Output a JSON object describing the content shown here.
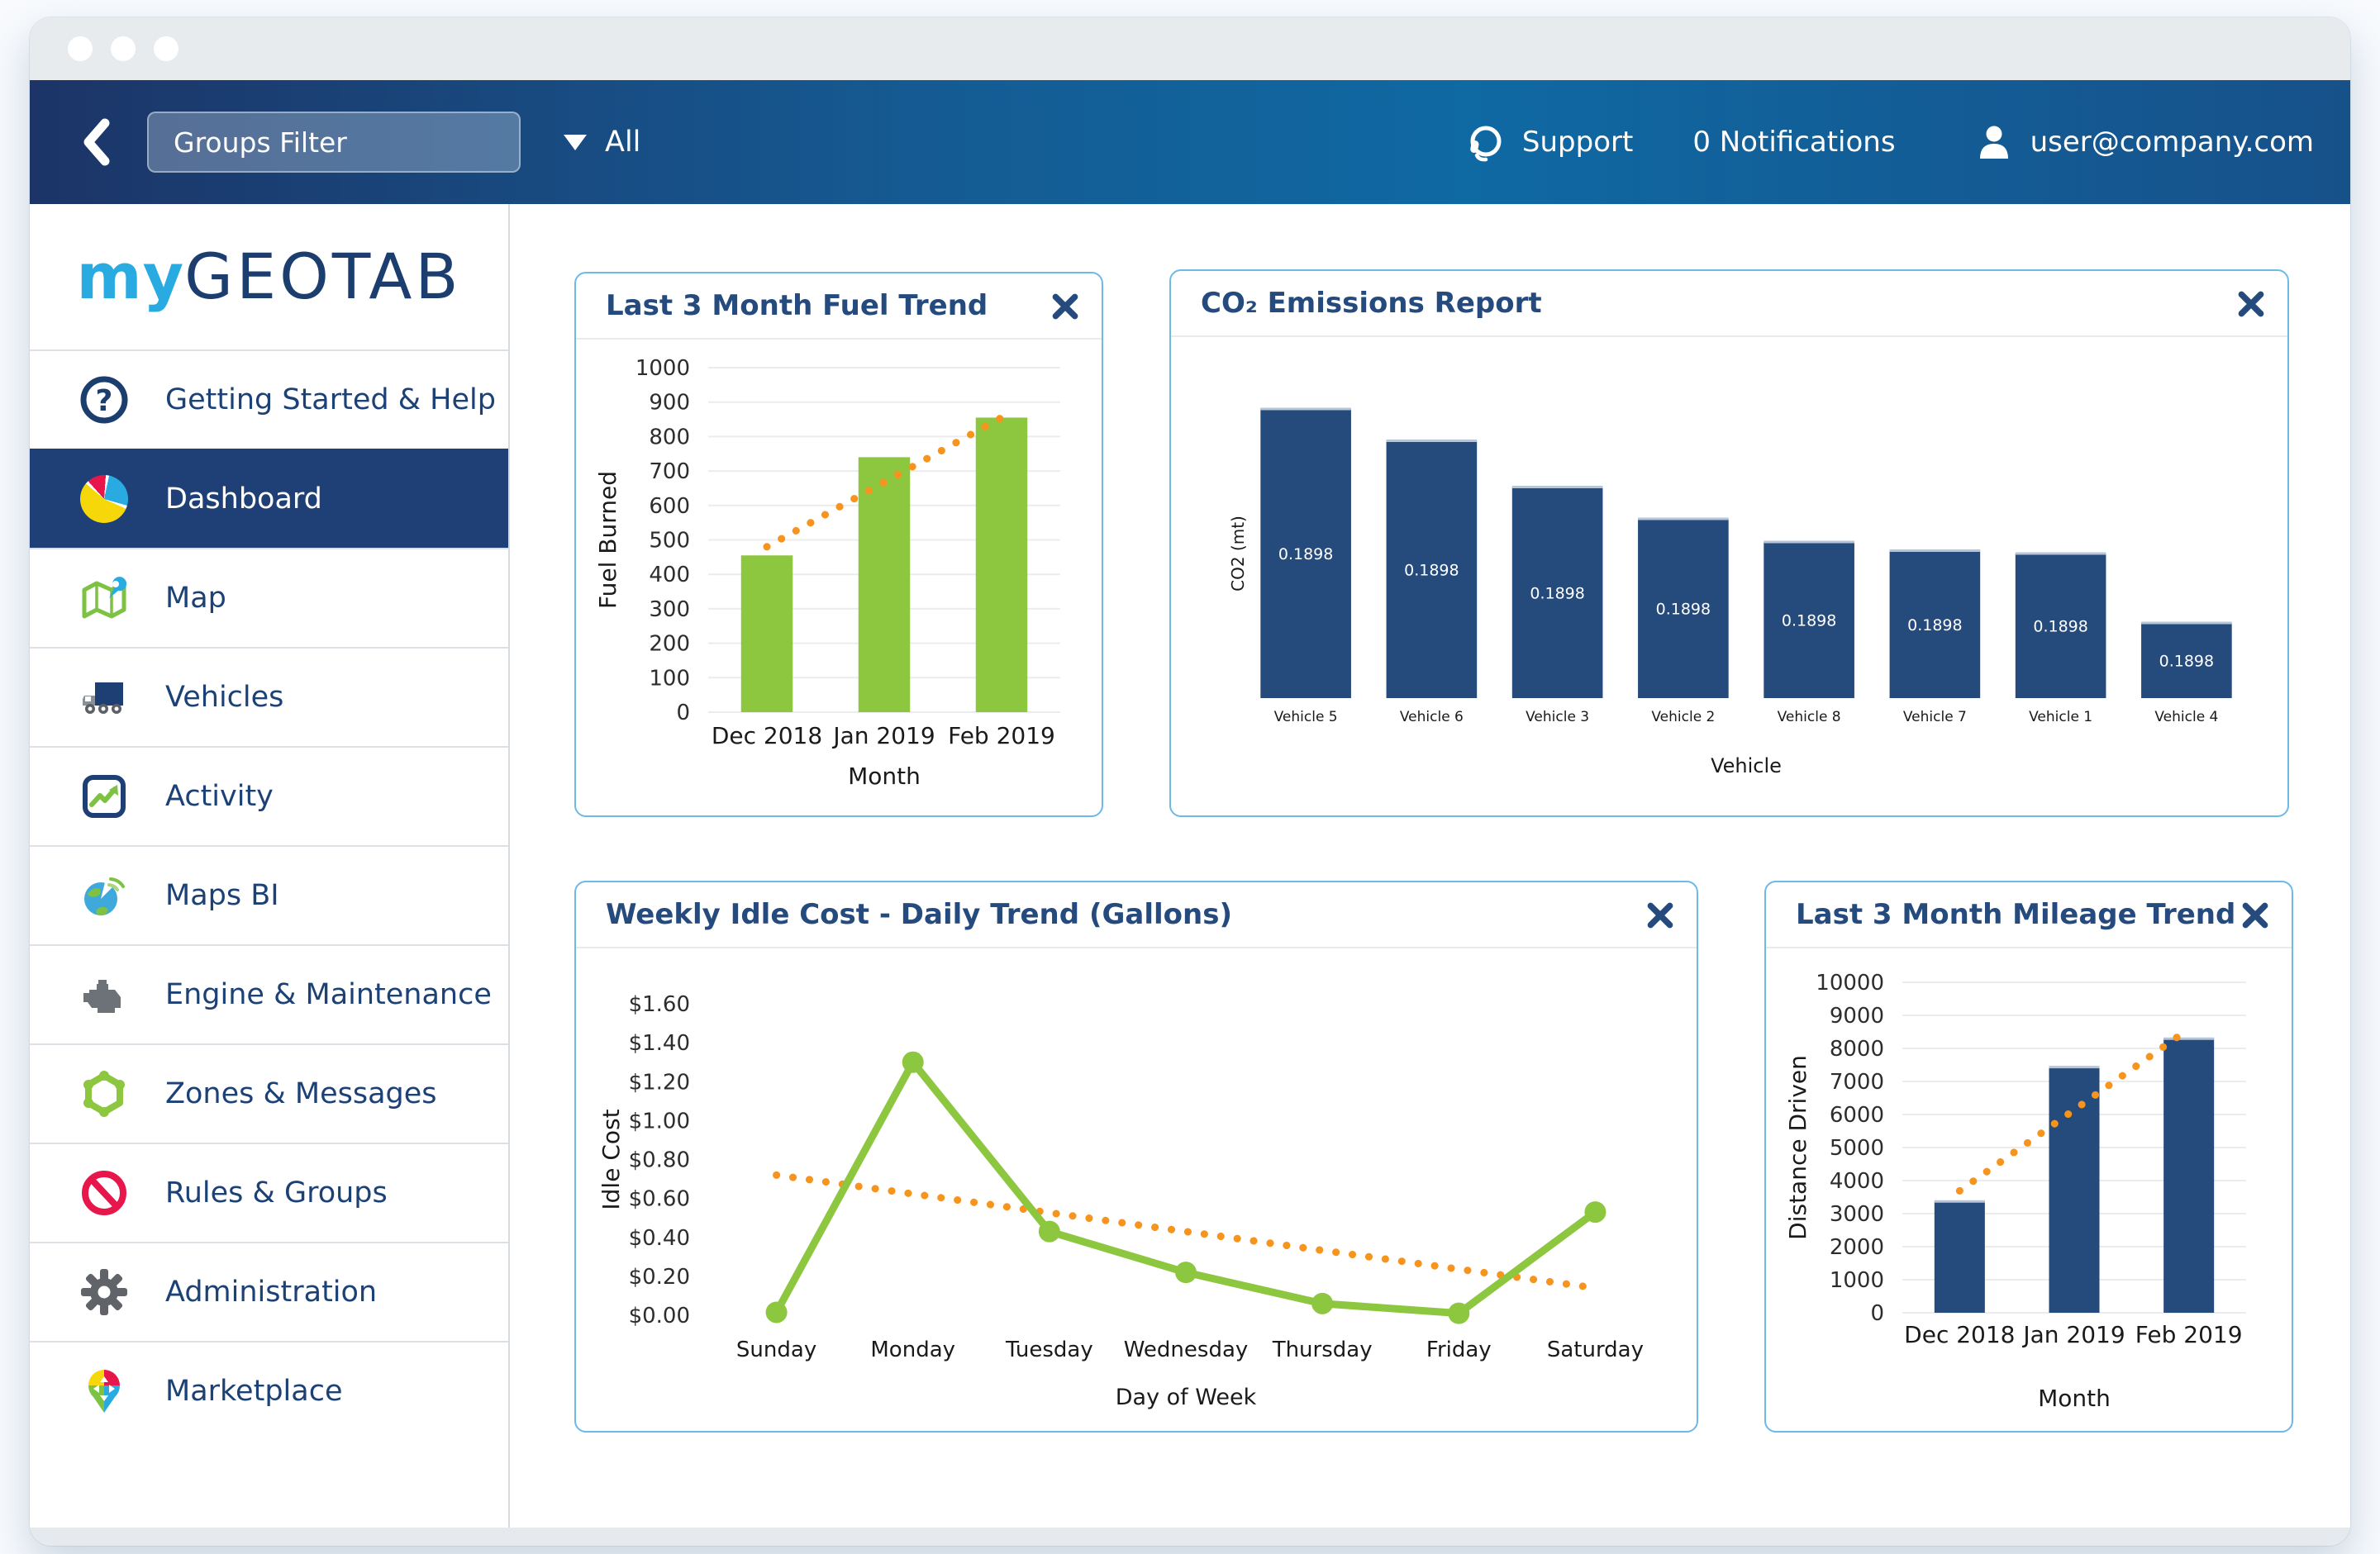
{
  "nav": {
    "groups_filter_label": "Groups Filter",
    "dropdown_value": "All",
    "support_label": "Support",
    "notifications_label": "0 Notifications",
    "user_email": "user@company.com"
  },
  "logo": {
    "part1": "my",
    "part2": "GEOTAB"
  },
  "sidebar": {
    "items": [
      {
        "label": "Getting Started & Help",
        "icon": "help-icon",
        "selected": false
      },
      {
        "label": "Dashboard",
        "icon": "dashboard-pie-icon",
        "selected": true
      },
      {
        "label": "Map",
        "icon": "map-icon",
        "selected": false
      },
      {
        "label": "Vehicles",
        "icon": "truck-icon",
        "selected": false
      },
      {
        "label": "Activity",
        "icon": "activity-icon",
        "selected": false
      },
      {
        "label": "Maps BI",
        "icon": "globe-icon",
        "selected": false
      },
      {
        "label": "Engine & Maintenance",
        "icon": "engine-icon",
        "selected": false
      },
      {
        "label": "Zones & Messages",
        "icon": "zones-icon",
        "selected": false
      },
      {
        "label": "Rules & Groups",
        "icon": "no-entry-icon",
        "selected": false
      },
      {
        "label": "Administration",
        "icon": "gear-icon",
        "selected": false
      },
      {
        "label": "Marketplace",
        "icon": "marketplace-pin-icon",
        "selected": false
      }
    ]
  },
  "colors": {
    "header_gradient": [
      "#1c3467",
      "#0f69a3",
      "#17518a"
    ],
    "accent_navy": "#1e4077",
    "title_navy": "#254a7d",
    "sidebar_text": "#1c4176",
    "logo_blue": "#29abe2",
    "logo_navy": "#1b3e6f",
    "green": "#8dc63f",
    "orange": "#f7941e",
    "bar_navy": "#254a7c",
    "card_border": "#6db9e8"
  },
  "chart_data": [
    {
      "id": "fuel_trend",
      "type": "bar",
      "title": "Last 3 Month Fuel Trend",
      "categories": [
        "Dec 2018",
        "Jan 2019",
        "Feb 2019"
      ],
      "values": [
        455,
        740,
        855
      ],
      "trendline": {
        "start": 480,
        "end": 855
      },
      "ylim": [
        0,
        1000
      ],
      "ytick_step": 100,
      "ytick_decimals": 0,
      "grid": true,
      "xlabel": "Month",
      "ylabel": "Fuel Burned",
      "bar_color": "#8dc63f",
      "trend_color": "#f7941e"
    },
    {
      "id": "co2_emissions",
      "type": "bar",
      "title": "CO₂ Emissions Report",
      "categories": [
        "Vehicle 5",
        "Vehicle 6",
        "Vehicle 3",
        "Vehicle 2",
        "Vehicle 8",
        "Vehicle 7",
        "Vehicle 1",
        "Vehicle 4"
      ],
      "values": [
        1.0,
        0.89,
        0.73,
        0.62,
        0.54,
        0.51,
        0.5,
        0.26
      ],
      "bar_labels": [
        "0.1898",
        "0.1898",
        "0.1898",
        "0.1898",
        "0.1898",
        "0.1898",
        "0.1898",
        "0.1898"
      ],
      "ylim": [
        0,
        1
      ],
      "grid": false,
      "xlabel": "Vehicle",
      "ylabel": "CO2 (mt)",
      "bar_color": "#254a7c"
    },
    {
      "id": "idle_cost",
      "type": "line",
      "title": "Weekly Idle Cost - Daily Trend (Gallons)",
      "categories": [
        "Sunday",
        "Monday",
        "Tuesday",
        "Wednesday",
        "Thursday",
        "Friday",
        "Saturday"
      ],
      "values": [
        0.015,
        1.3,
        0.43,
        0.22,
        0.06,
        0.01,
        0.53
      ],
      "trendline": {
        "start": 0.72,
        "end": 0.14
      },
      "ylim": [
        0,
        1.6
      ],
      "ytick_step": 0.2,
      "ytick_prefix": "$",
      "ytick_decimals": 2,
      "grid": false,
      "xlabel": "Day of Week",
      "ylabel": "Idle Cost",
      "line_color": "#8dc63f",
      "trend_color": "#f7941e"
    },
    {
      "id": "mileage_trend",
      "type": "bar",
      "title": "Last 3 Month Mileage Trend",
      "categories": [
        "Dec 2018",
        "Jan 2019",
        "Feb 2019"
      ],
      "values": [
        3370,
        7435,
        8295
      ],
      "trendline": {
        "start": 3690,
        "end": 8590
      },
      "ylim": [
        0,
        10000
      ],
      "ytick_step": 1000,
      "ytick_decimals": 0,
      "grid": true,
      "xlabel": "Month",
      "ylabel": "Distance Driven",
      "bar_color": "#254a7c",
      "trend_color": "#f7941e"
    }
  ]
}
